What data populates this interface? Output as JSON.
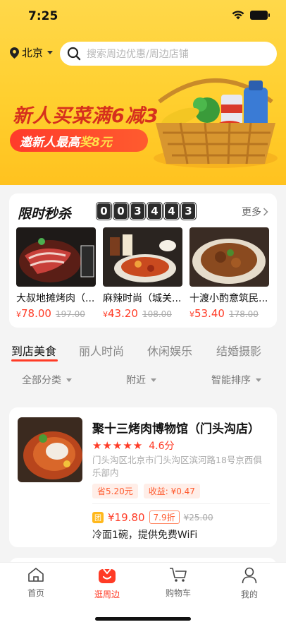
{
  "status_bar": {
    "time": "7:25"
  },
  "header": {
    "city": "北京",
    "search_placeholder": "搜索周边优惠/周边店铺"
  },
  "banner": {
    "headline": "新人买菜满6减3",
    "sub_prefix": "邀新人最高",
    "sub_highlight": "奖8元"
  },
  "flash_sale": {
    "title": "限时秒杀",
    "countdown": [
      "0",
      "0",
      "3",
      "4",
      "4",
      "3"
    ],
    "more_label": "更多",
    "items": [
      {
        "name": "大叔地摊烤肉（...",
        "currency": "¥",
        "price": "78.00",
        "original": "197.00"
      },
      {
        "name": "麻辣时尚（城关...",
        "currency": "¥",
        "price": "43.20",
        "original": "108.00"
      },
      {
        "name": "十渡小酌意筑民...",
        "currency": "¥",
        "price": "53.40",
        "original": "178.00"
      }
    ]
  },
  "categories": [
    "到店美食",
    "丽人时尚",
    "休闲娱乐",
    "结婚摄影"
  ],
  "filters": [
    "全部分类",
    "附近",
    "智能排序"
  ],
  "store": {
    "name": "聚十三烤肉博物馆（门头沟店）",
    "stars": "★★★★★",
    "score": "4.6分",
    "address": "门头沟区北京市门头沟区滨河路18号京西俱乐部内",
    "tag_save": "省5.20元",
    "tag_earn": "收益: ¥0.47",
    "tuan_label": "团",
    "deal_price": "¥19.80",
    "discount": "7.9折",
    "deal_original": "¥25.00",
    "deal_desc": "冷面1碗，提供免费WiFi"
  },
  "tabbar": [
    {
      "label": "首页",
      "icon": "home-icon"
    },
    {
      "label": "逛周边",
      "icon": "nearby-icon"
    },
    {
      "label": "购物车",
      "icon": "cart-icon"
    },
    {
      "label": "我的",
      "icon": "profile-icon"
    }
  ],
  "colors": {
    "accent": "#ff3b26",
    "banner": "#ffd84a",
    "promo_text": "#d6301d"
  }
}
